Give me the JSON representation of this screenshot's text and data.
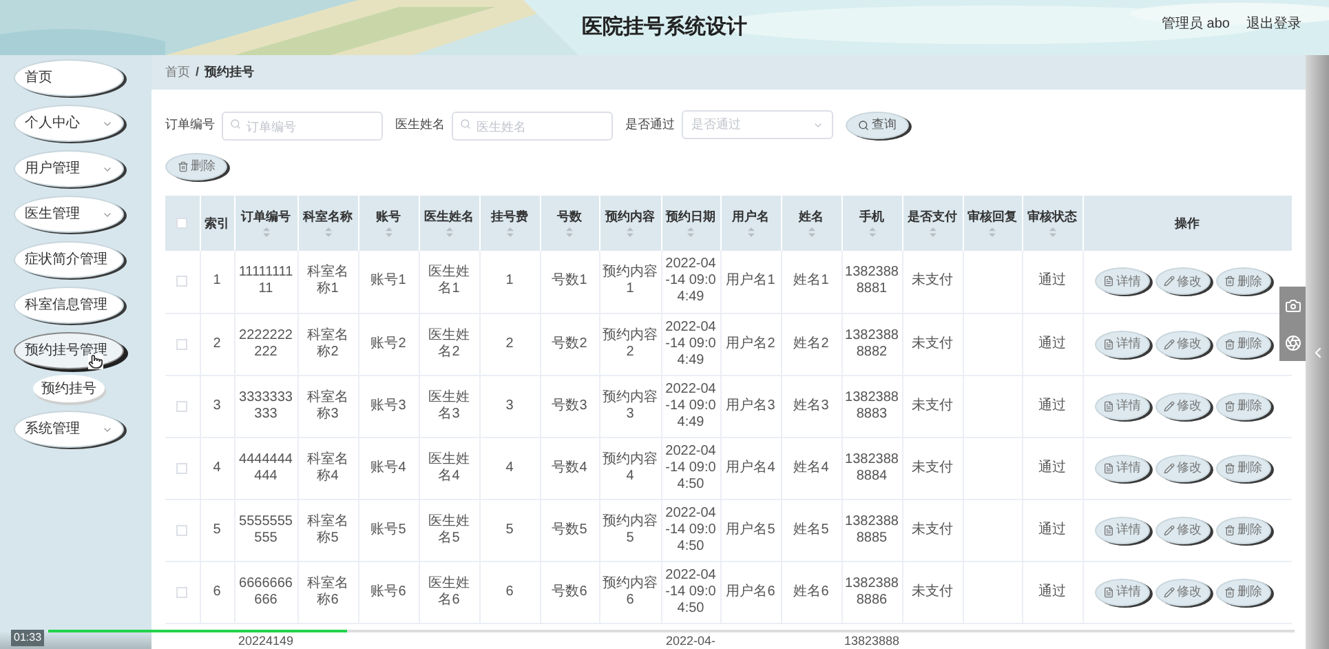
{
  "header": {
    "title": "医院挂号系统设计",
    "user": "管理员 abo",
    "logout": "退出登录"
  },
  "sidebar": {
    "items": [
      {
        "label": "首页",
        "chevron": false,
        "hovered": false
      },
      {
        "label": "个人中心",
        "chevron": true,
        "hovered": false
      },
      {
        "label": "用户管理",
        "chevron": true,
        "hovered": false
      },
      {
        "label": "医生管理",
        "chevron": true,
        "hovered": false
      },
      {
        "label": "症状简介管理",
        "chevron": false,
        "hovered": false
      },
      {
        "label": "科室信息管理",
        "chevron": false,
        "hovered": false
      },
      {
        "label": "预约挂号管理",
        "chevron": false,
        "hovered": true,
        "children": [
          {
            "label": "预约挂号"
          }
        ]
      },
      {
        "label": "系统管理",
        "chevron": true,
        "hovered": false
      }
    ]
  },
  "breadcrumb": {
    "items": [
      "首页",
      "预约挂号"
    ],
    "separator": "/"
  },
  "search": {
    "fields": [
      {
        "kind": "input",
        "label": "订单编号",
        "placeholder": "订单编号"
      },
      {
        "kind": "input",
        "label": "医生姓名",
        "placeholder": "医生姓名"
      },
      {
        "kind": "select",
        "label": "是否通过",
        "placeholder": "是否通过"
      }
    ],
    "button": "查询"
  },
  "delete_button": "删除",
  "table": {
    "header_checked": false,
    "columns": [
      {
        "label": "索引",
        "sortable": false
      },
      {
        "label": "订单编号",
        "sortable": true
      },
      {
        "label": "科室名称",
        "sortable": true
      },
      {
        "label": "账号",
        "sortable": true
      },
      {
        "label": "医生姓名",
        "sortable": true
      },
      {
        "label": "挂号费",
        "sortable": true
      },
      {
        "label": "号数",
        "sortable": true
      },
      {
        "label": "预约内容",
        "sortable": true
      },
      {
        "label": "预约日期",
        "sortable": true
      },
      {
        "label": "用户名",
        "sortable": true
      },
      {
        "label": "姓名",
        "sortable": true
      },
      {
        "label": "手机",
        "sortable": true
      },
      {
        "label": "是否支付",
        "sortable": true
      },
      {
        "label": "审核回复",
        "sortable": true
      },
      {
        "label": "审核状态",
        "sortable": true
      },
      {
        "label": "操作",
        "sortable": false
      }
    ],
    "rows": [
      {
        "checked": false,
        "cells": [
          "1",
          "1111111111",
          "科室名称1",
          "账号1",
          "医生姓名1",
          "1",
          "号数1",
          "预约内容1",
          "2022-04-14 09:04:49",
          "用户名1",
          "姓名1",
          "13823888881",
          "未支付",
          null,
          "通过"
        ],
        "actions": [
          {
            "kind": "detail",
            "label": "详情"
          },
          {
            "kind": "edit",
            "label": "修改"
          },
          {
            "kind": "delete",
            "label": "删除"
          }
        ]
      },
      {
        "checked": false,
        "cells": [
          "2",
          "2222222222",
          "科室名称2",
          "账号2",
          "医生姓名2",
          "2",
          "号数2",
          "预约内容2",
          "2022-04-14 09:04:49",
          "用户名2",
          "姓名2",
          "13823888882",
          "未支付",
          null,
          "通过"
        ],
        "actions": [
          {
            "kind": "detail",
            "label": "详情"
          },
          {
            "kind": "edit",
            "label": "修改"
          },
          {
            "kind": "delete",
            "label": "删除"
          }
        ]
      },
      {
        "checked": false,
        "cells": [
          "3",
          "3333333333",
          "科室名称3",
          "账号3",
          "医生姓名3",
          "3",
          "号数3",
          "预约内容3",
          "2022-04-14 09:04:49",
          "用户名3",
          "姓名3",
          "13823888883",
          "未支付",
          null,
          "通过"
        ],
        "actions": [
          {
            "kind": "detail",
            "label": "详情"
          },
          {
            "kind": "edit",
            "label": "修改"
          },
          {
            "kind": "delete",
            "label": "删除"
          }
        ]
      },
      {
        "checked": false,
        "cells": [
          "4",
          "4444444444",
          "科室名称4",
          "账号4",
          "医生姓名4",
          "4",
          "号数4",
          "预约内容4",
          "2022-04-14 09:04:50",
          "用户名4",
          "姓名4",
          "13823888884",
          "未支付",
          null,
          "通过"
        ],
        "actions": [
          {
            "kind": "detail",
            "label": "详情"
          },
          {
            "kind": "edit",
            "label": "修改"
          },
          {
            "kind": "delete",
            "label": "删除"
          }
        ]
      },
      {
        "checked": false,
        "cells": [
          "5",
          "5555555555",
          "科室名称5",
          "账号5",
          "医生姓名5",
          "5",
          "号数5",
          "预约内容5",
          "2022-04-14 09:04:50",
          "用户名5",
          "姓名5",
          "13823888885",
          "未支付",
          null,
          "通过"
        ],
        "actions": [
          {
            "kind": "detail",
            "label": "详情"
          },
          {
            "kind": "edit",
            "label": "修改"
          },
          {
            "kind": "delete",
            "label": "删除"
          }
        ]
      },
      {
        "checked": false,
        "cells": [
          "6",
          "6666666666",
          "科室名称6",
          "账号6",
          "医生姓名6",
          "6",
          "号数6",
          "预约内容6",
          "2022-04-14 09:04:50",
          "用户名6",
          "姓名6",
          "13823888886",
          "未支付",
          null,
          "通过"
        ],
        "actions": [
          {
            "kind": "detail",
            "label": "详情"
          },
          {
            "kind": "edit",
            "label": "修改"
          },
          {
            "kind": "delete",
            "label": "删除"
          }
        ]
      },
      {
        "partial": true,
        "cells": [
          null,
          "20224149",
          null,
          null,
          null,
          null,
          null,
          null,
          "2022-04-",
          null,
          null,
          "13823888",
          null,
          null,
          null
        ]
      }
    ]
  },
  "player": {
    "time": "01:33",
    "level": 0.24
  }
}
